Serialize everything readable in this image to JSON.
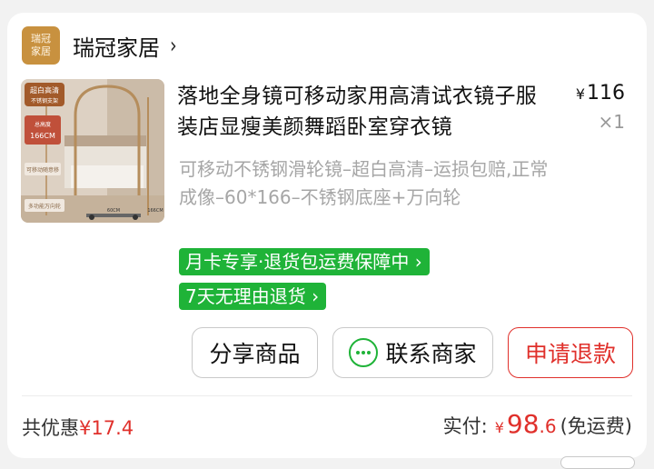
{
  "shop": {
    "logo_line1": "瑞冠",
    "logo_line2": "家居",
    "name": "瑞冠家居",
    "chevron": "›",
    "logo_color": "#c8913f"
  },
  "product": {
    "title": "落地全身镜可移动家用高清试衣镜子服装店显瘦美颜舞蹈卧室穿衣镜",
    "currency": "¥",
    "price": "116",
    "qty": "×1",
    "spec": "可移动不锈钢滑轮镜–超白高清–运损包赔,正常成像–60*166–不锈钢底座+万向轮",
    "thumb_badge_line1": "超白高清",
    "thumb_badge_line2": "不锈钢支架",
    "thumb_height_label": "总高度",
    "thumb_height_value": "166CM",
    "thumb_opt1": "可移动随意移",
    "thumb_opt2": "多功能万向轮",
    "thumb_width_label": "60CM",
    "thumb_side_label": "166CM"
  },
  "tags": {
    "tag1": "月卡专享·退货包运费保障中",
    "tag2": "7天无理由退货",
    "arrow": "›",
    "color": "#1fb338"
  },
  "actions": {
    "share": "分享商品",
    "contact": "联系商家",
    "refund": "申请退款",
    "refund_color": "#e0302b"
  },
  "summary": {
    "discount_label": "共优惠",
    "discount_value": "¥17.4",
    "paid_label": "实付:",
    "paid_currency": "¥",
    "paid_int": "98",
    "paid_dec": ".6",
    "paid_note": "(免运费)",
    "accent_color": "#e0302b"
  }
}
